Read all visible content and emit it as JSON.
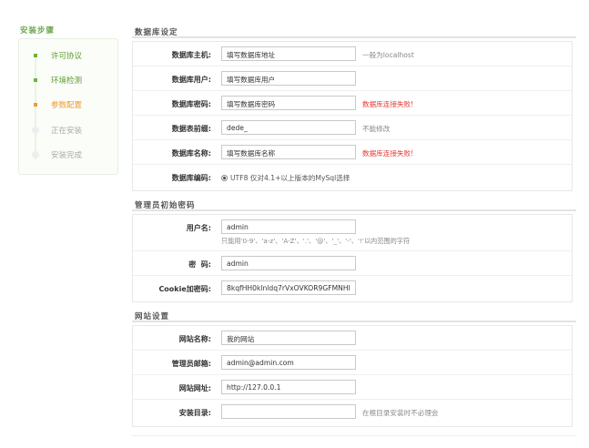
{
  "sidebar": {
    "title": "安装步骤",
    "steps": [
      {
        "label": "许可协议",
        "state": "done"
      },
      {
        "label": "环境检测",
        "state": "done"
      },
      {
        "label": "参数配置",
        "state": "active"
      },
      {
        "label": "正在安装",
        "state": "todo"
      },
      {
        "label": "安装完成",
        "state": "todo"
      }
    ]
  },
  "db": {
    "title": "数据库设定",
    "host_label": "数据库主机:",
    "host_value": "填写数据库地址",
    "host_tip": "一般为localhost",
    "user_label": "数据库用户:",
    "user_value": "填写数据库用户",
    "pass_label": "数据库密码:",
    "pass_value": "填写数据库密码",
    "pass_tip": "数据库连接失败!",
    "prefix_label": "数据表前缀:",
    "prefix_value": "dede_",
    "prefix_tip": "不能修改",
    "name_label": "数据库名称:",
    "name_value": "填写数据库名称",
    "name_tip": "数据库连接失败!",
    "charset_label": "数据库编码:",
    "charset_text": "UTF8 仅对4.1+以上版本的MySql选择"
  },
  "admin": {
    "title": "管理员初始密码",
    "user_label": "用户名:",
    "user_value": "admin",
    "user_hint": "只能用'0-9'、'a-z'、'A-Z'、'.'、'@'、'_'、'-'、'!'以内范围的字符",
    "pass_label": "密  码:",
    "pass_value": "admin",
    "cookie_label": "Cookie加密码:",
    "cookie_value": "8kqfHH0klnldq7rVxOVKOR9GFMNHI"
  },
  "site": {
    "title": "网站设置",
    "name_label": "网站名称:",
    "name_value": "我的网站",
    "email_label": "管理员邮箱:",
    "email_value": "admin@admin.com",
    "url_label": "网站网址:",
    "url_value": "http://127.0.0.1",
    "dir_label": "安装目录:",
    "dir_value": "",
    "dir_tip": "在根目录安装时不必理会"
  },
  "colors": {
    "done": "#5a9c2c",
    "active": "#f39a2c",
    "error": "#e53935"
  }
}
